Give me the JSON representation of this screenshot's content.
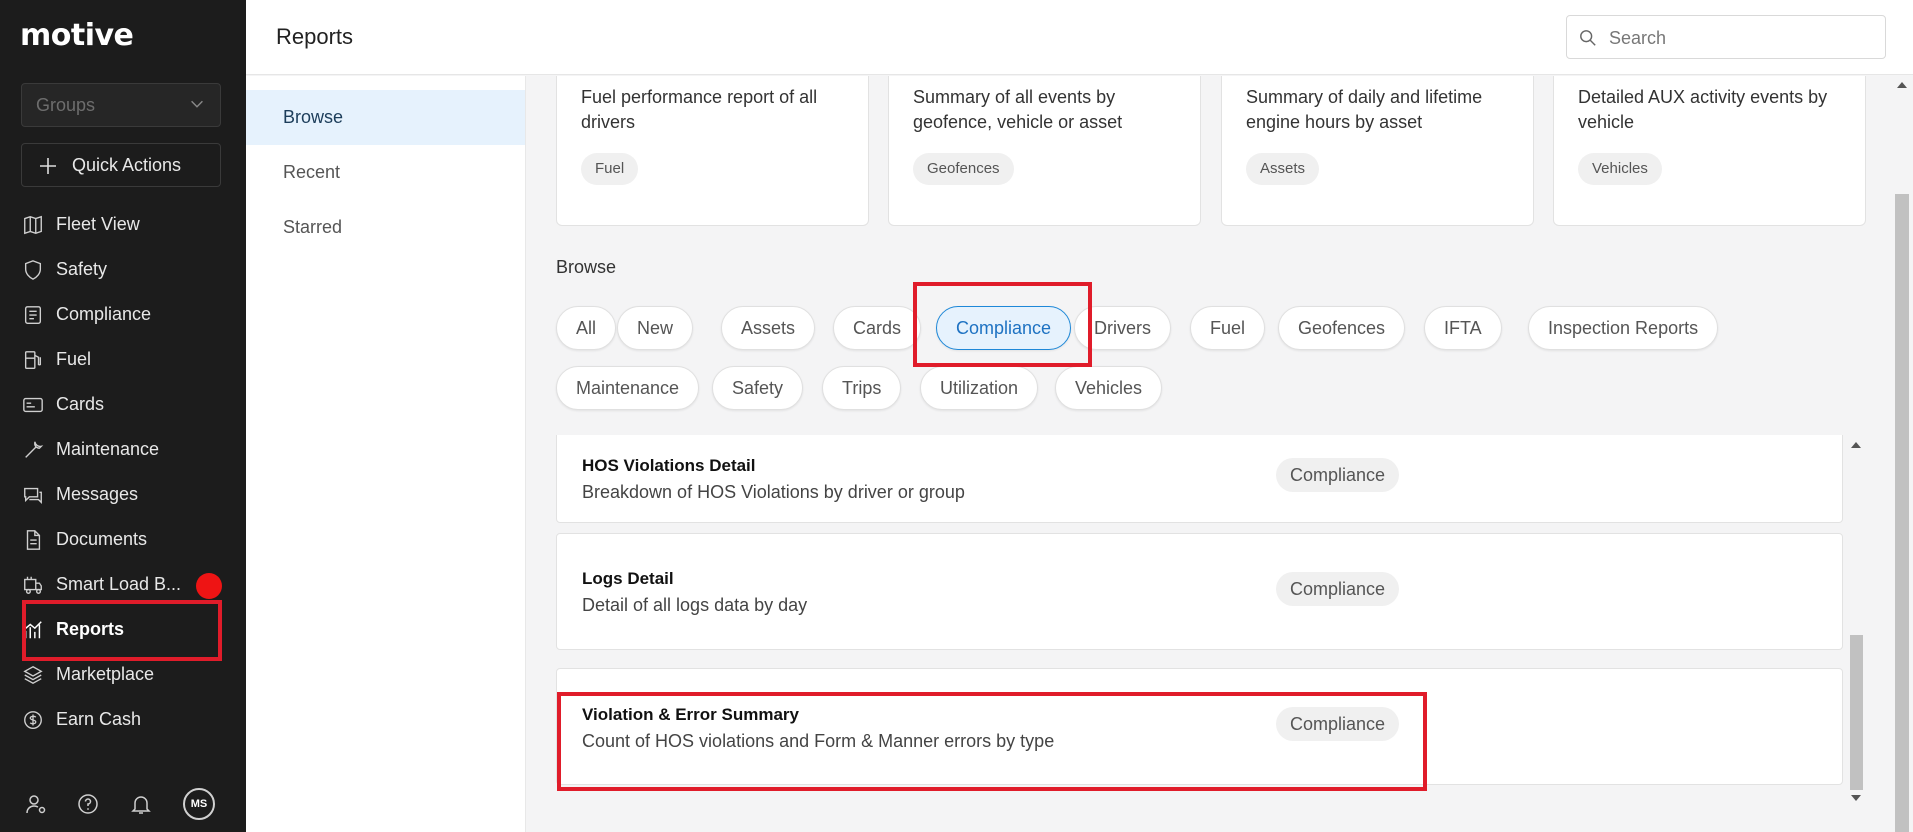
{
  "app": {
    "logo_text": "motive"
  },
  "sidebar": {
    "groups_placeholder": "Groups",
    "quick_actions_label": "Quick Actions",
    "items": [
      {
        "label": "Fleet View",
        "icon": "map-icon"
      },
      {
        "label": "Safety",
        "icon": "shield-icon"
      },
      {
        "label": "Compliance",
        "icon": "document-list-icon"
      },
      {
        "label": "Fuel",
        "icon": "fuel-pump-icon"
      },
      {
        "label": "Cards",
        "icon": "card-icon"
      },
      {
        "label": "Maintenance",
        "icon": "wrench-icon"
      },
      {
        "label": "Messages",
        "icon": "chat-icon"
      },
      {
        "label": "Documents",
        "icon": "file-icon"
      },
      {
        "label": "Smart Load B...",
        "icon": "truck-load-icon"
      },
      {
        "label": "Reports",
        "icon": "chart-icon",
        "active": true
      },
      {
        "label": "Marketplace",
        "icon": "layers-icon"
      },
      {
        "label": "Earn Cash",
        "icon": "dollar-circle-icon"
      }
    ],
    "footer": {
      "avatar_initials": "MS"
    }
  },
  "header": {
    "title": "Reports",
    "search_placeholder": "Search"
  },
  "subnav": {
    "items": [
      "Browse",
      "Recent",
      "Starred"
    ],
    "active": "Browse"
  },
  "top_cards": [
    {
      "desc": "Fuel performance report of all drivers",
      "tag": "Fuel"
    },
    {
      "desc": "Summary of all events by geofence, vehicle or asset",
      "tag": "Geofences"
    },
    {
      "desc": "Summary of daily and lifetime engine hours by asset",
      "tag": "Assets"
    },
    {
      "desc": "Detailed AUX activity events by vehicle",
      "tag": "Vehicles"
    }
  ],
  "browse": {
    "title": "Browse",
    "filters": [
      "All",
      "New",
      "Assets",
      "Cards",
      "Compliance",
      "Drivers",
      "Fuel",
      "Geofences",
      "IFTA",
      "Inspection Reports",
      "Maintenance",
      "Safety",
      "Trips",
      "Utilization",
      "Vehicles"
    ],
    "active_filter": "Compliance"
  },
  "reports": [
    {
      "name": "HOS Violations Detail",
      "desc": "Breakdown of HOS Violations by driver or group",
      "tag": "Compliance"
    },
    {
      "name": "Logs Detail",
      "desc": "Detail of all logs data by day",
      "tag": "Compliance"
    },
    {
      "name": "Violation & Error Summary",
      "desc": "Count of HOS violations and Form & Manner errors by type",
      "tag": "Compliance"
    }
  ],
  "colors": {
    "accent": "#1e88d8",
    "highlight": "#e01c2a",
    "sidebar_bg": "#1c1c1c",
    "badge": "#ee1414"
  }
}
